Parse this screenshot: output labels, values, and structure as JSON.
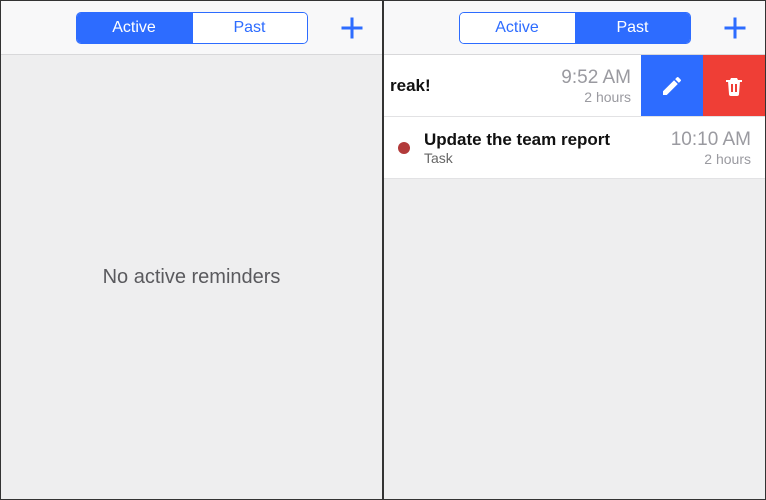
{
  "colors": {
    "accent": "#2d6cff",
    "danger": "#ef3e36"
  },
  "left": {
    "tabs": {
      "active": "Active",
      "past": "Past"
    },
    "selected_tab": "Active",
    "empty_text": "No active reminders"
  },
  "right": {
    "tabs": {
      "active": "Active",
      "past": "Past"
    },
    "selected_tab": "Past",
    "rows": [
      {
        "swiped": true,
        "title_fragment": "reak!",
        "time": "9:52 AM",
        "duration": "2 hours",
        "actions": {
          "edit_icon": "pencil",
          "delete_icon": "trash"
        }
      },
      {
        "swiped": false,
        "dot_color": "#b23a3a",
        "title": "Update the team report",
        "subtitle": "Task",
        "time": "10:10 AM",
        "duration": "2 hours"
      }
    ]
  }
}
